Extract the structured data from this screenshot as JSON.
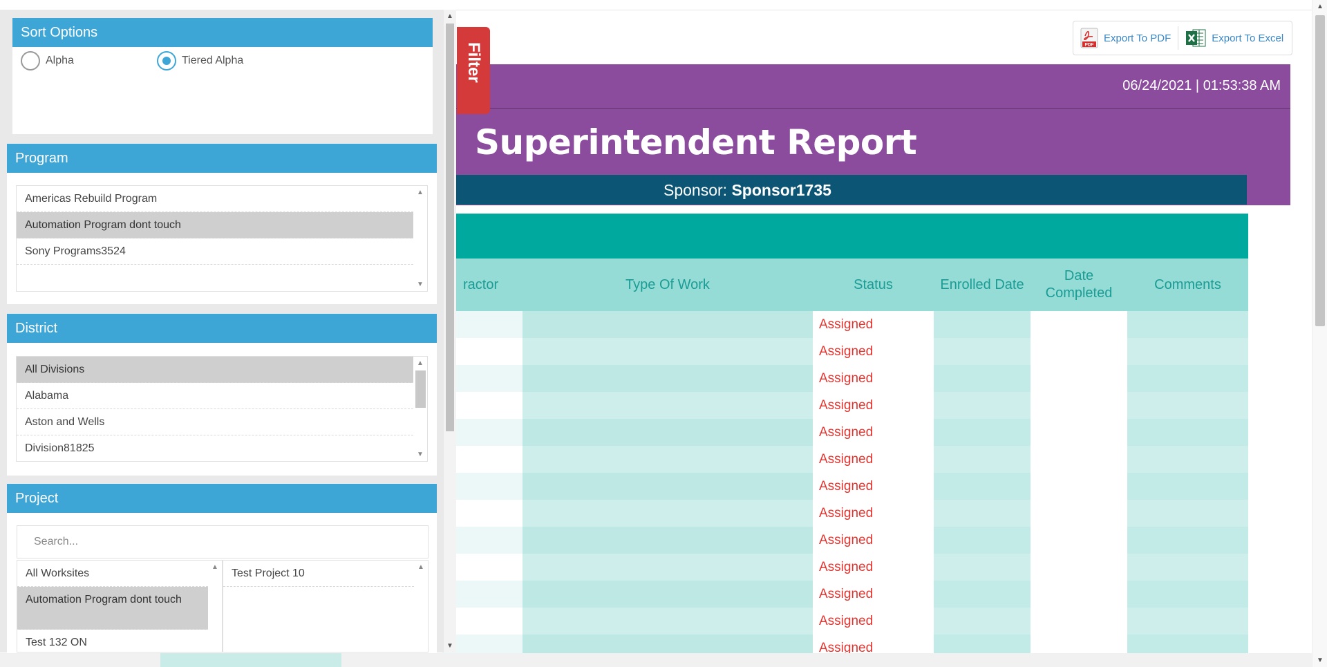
{
  "export": {
    "pdf_label": "Export To PDF",
    "pdf_icon_text": "PDF",
    "excel_label": "Export To Excel"
  },
  "report": {
    "datetime": "06/24/2021 | 01:53:38 AM",
    "title": "Superintendent Report",
    "sponsor_prefix": "Sponsor:",
    "sponsor_name": "Sponsor1735",
    "columns": [
      "ractor",
      "Type Of Work",
      "Status",
      "Enrolled Date",
      "Date Completed",
      "Comments"
    ],
    "rows": [
      {
        "status": "Assigned"
      },
      {
        "status": "Assigned"
      },
      {
        "status": "Assigned"
      },
      {
        "status": "Assigned"
      },
      {
        "status": "Assigned"
      },
      {
        "status": "Assigned"
      },
      {
        "status": "Assigned"
      },
      {
        "status": "Assigned"
      },
      {
        "status": "Assigned"
      },
      {
        "status": "Assigned"
      },
      {
        "status": "Assigned"
      },
      {
        "status": "Assigned"
      },
      {
        "status": "Assigned"
      }
    ]
  },
  "filter": {
    "tab_label": "Filter",
    "sort_options": {
      "header": "Sort Options",
      "options": [
        {
          "label": "Alpha",
          "selected": false
        },
        {
          "label": "Tiered Alpha",
          "selected": true
        }
      ]
    },
    "program": {
      "header": "Program",
      "items": [
        {
          "label": "Americas Rebuild Program",
          "selected": false
        },
        {
          "label": "Automation Program dont touch",
          "selected": true
        },
        {
          "label": "Sony Programs3524",
          "selected": false
        }
      ]
    },
    "district": {
      "header": "District",
      "items": [
        {
          "label": "All Divisions",
          "selected": true
        },
        {
          "label": "Alabama",
          "selected": false
        },
        {
          "label": "Aston and Wells",
          "selected": false
        },
        {
          "label": "Division81825",
          "selected": false
        }
      ]
    },
    "project": {
      "header": "Project",
      "search_placeholder": "Search...",
      "left_items": [
        {
          "label": "All Worksites",
          "selected": false
        },
        {
          "label": "Automation Program dont touch",
          "selected": true
        },
        {
          "label": "Test 132 ON",
          "selected": false
        }
      ],
      "right_items": [
        {
          "label": "Test Project 10",
          "selected": false
        }
      ]
    }
  },
  "colors": {
    "purple": "#8b4c9e",
    "navy": "#0d5574",
    "teal": "#00a99d",
    "header_blue": "#3ea6d7",
    "filter_red": "#d43a3a",
    "status_red": "#e3342f"
  }
}
